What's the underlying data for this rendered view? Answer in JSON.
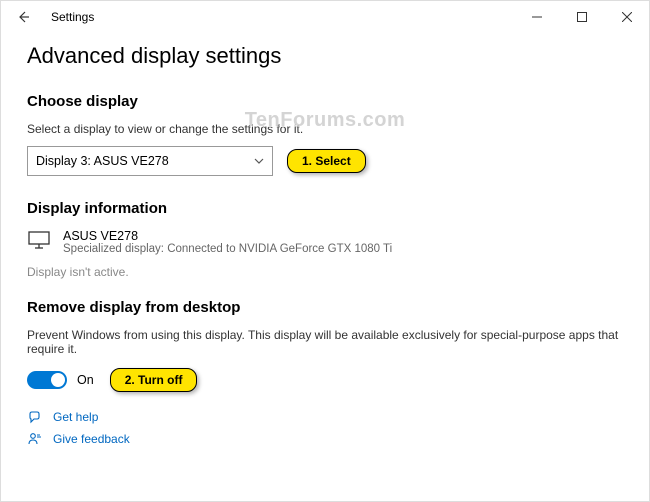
{
  "window": {
    "title": "Settings"
  },
  "page": {
    "heading": "Advanced display settings"
  },
  "choose": {
    "heading": "Choose display",
    "helper": "Select a display to view or change the settings for it.",
    "dropdown_value": "Display 3: ASUS VE278"
  },
  "callouts": {
    "select": "1.  Select",
    "turnoff": "2.  Turn off"
  },
  "info": {
    "heading": "Display information",
    "name": "ASUS VE278",
    "desc": "Specialized display: Connected to NVIDIA GeForce GTX 1080 Ti",
    "inactive": "Display isn't active."
  },
  "remove": {
    "heading": "Remove display from desktop",
    "desc": "Prevent Windows from using this display. This display will be available exclusively for special-purpose apps that require it.",
    "toggle_label": "On"
  },
  "links": {
    "help": "Get help",
    "feedback": "Give feedback"
  },
  "watermark": "TenForums.com"
}
